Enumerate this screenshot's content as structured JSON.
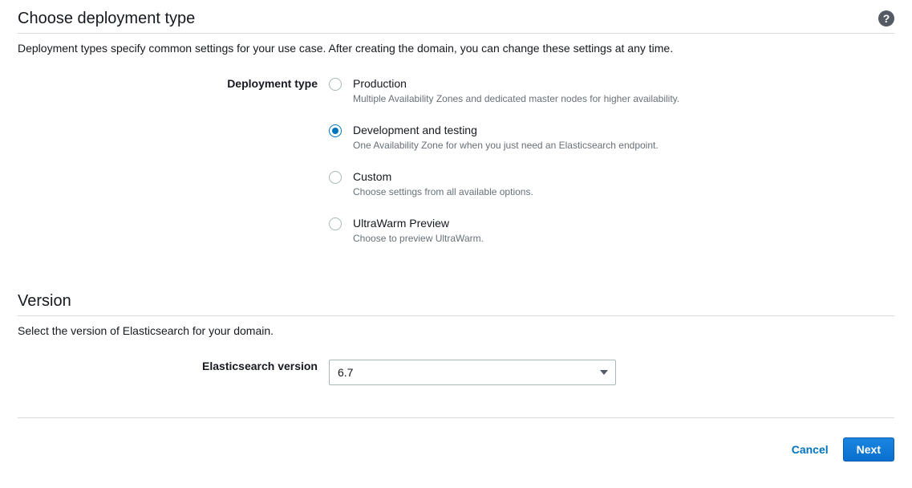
{
  "deployment": {
    "title": "Choose deployment type",
    "help_icon": "?",
    "desc": "Deployment types specify common settings for your use case. After creating the domain, you can change these settings at any time.",
    "field_label": "Deployment type",
    "selected_index": 1,
    "options": [
      {
        "label": "Production",
        "desc": "Multiple Availability Zones and dedicated master nodes for higher availability."
      },
      {
        "label": "Development and testing",
        "desc": "One Availability Zone for when you just need an Elasticsearch endpoint."
      },
      {
        "label": "Custom",
        "desc": "Choose settings from all available options."
      },
      {
        "label": "UltraWarm Preview",
        "desc": "Choose to preview UltraWarm."
      }
    ]
  },
  "version": {
    "title": "Version",
    "desc": "Select the version of Elasticsearch for your domain.",
    "field_label": "Elasticsearch version",
    "selected": "6.7"
  },
  "footer": {
    "cancel": "Cancel",
    "next": "Next"
  }
}
